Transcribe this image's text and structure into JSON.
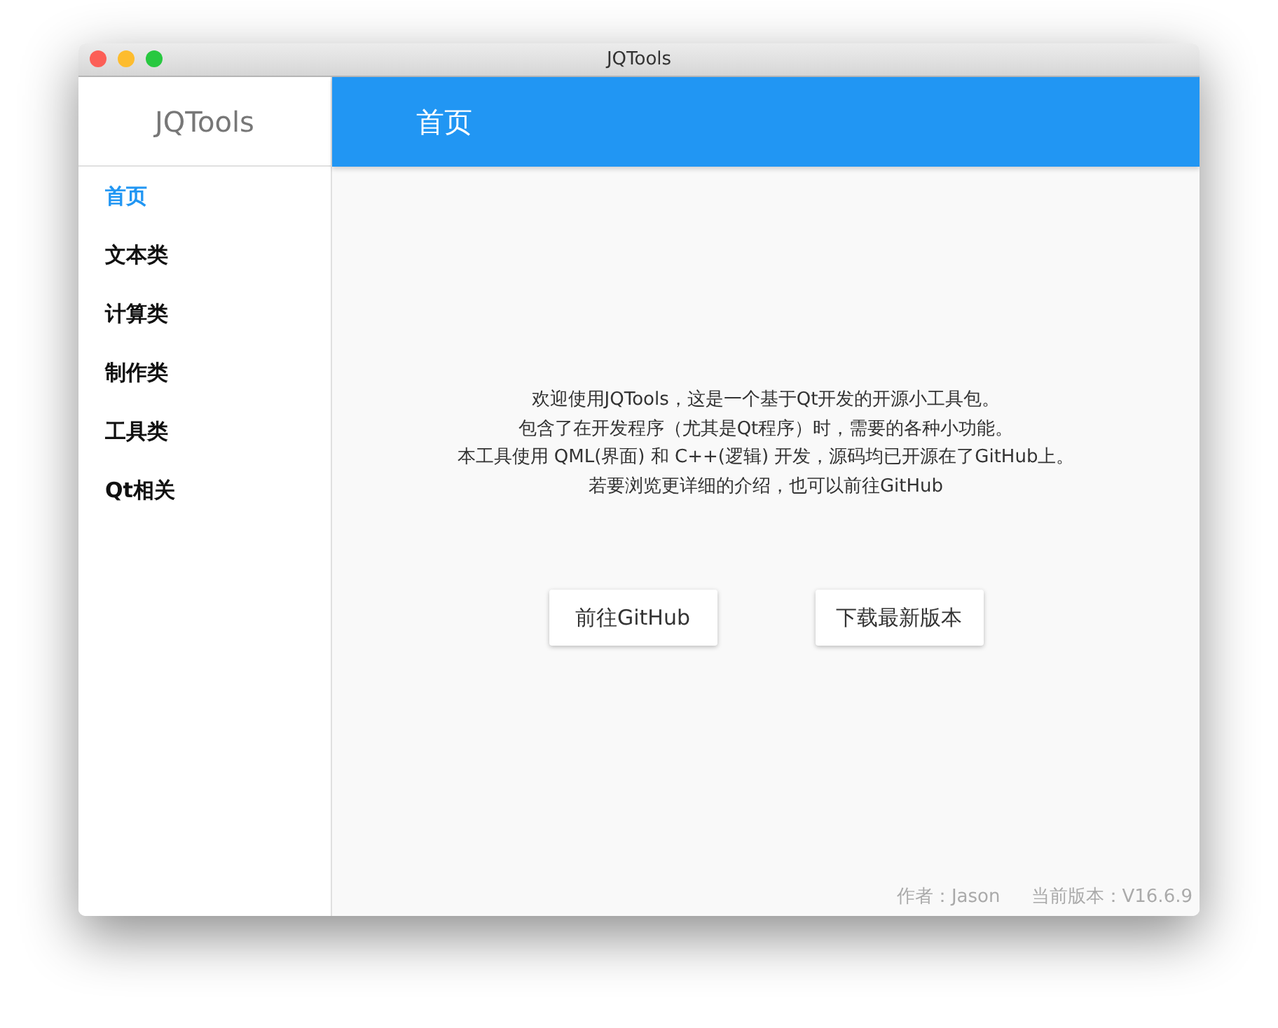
{
  "window": {
    "title": "JQTools"
  },
  "sidebar": {
    "app_name": "JQTools",
    "items": [
      {
        "label": "首页",
        "selected": true
      },
      {
        "label": "文本类",
        "selected": false
      },
      {
        "label": "计算类",
        "selected": false
      },
      {
        "label": "制作类",
        "selected": false
      },
      {
        "label": "工具类",
        "selected": false
      },
      {
        "label": "Qt相关",
        "selected": false
      }
    ]
  },
  "header": {
    "title": "首页"
  },
  "intro_lines": [
    "欢迎使用JQTools，这是一个基于Qt开发的开源小工具包。",
    "包含了在开发程序（尤其是Qt程序）时，需要的各种小功能。",
    "本工具使用 QML(界面) 和 C++(逻辑) 开发，源码均已开源在了GitHub上。",
    "若要浏览更详细的介绍，也可以前往GitHub"
  ],
  "buttons": [
    "前往GitHub",
    "下载最新版本"
  ],
  "footer": {
    "author": "作者：Jason",
    "version": "当前版本：V16.6.9"
  }
}
